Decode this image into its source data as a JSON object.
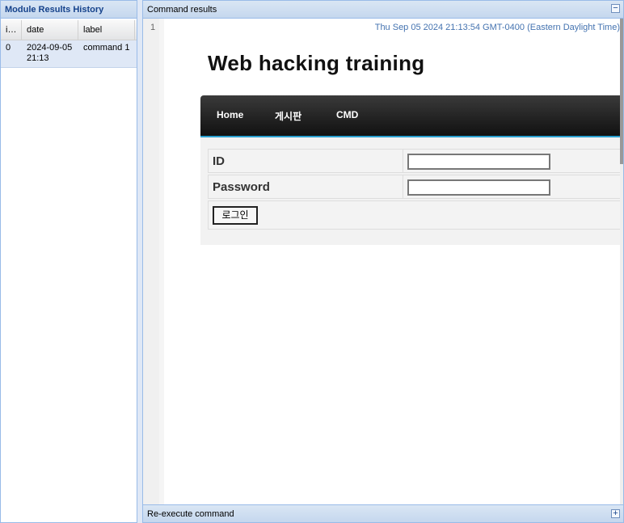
{
  "history_panel": {
    "title": "Module Results History",
    "columns": [
      "i…",
      "date",
      "label"
    ],
    "rows": [
      {
        "id": "0",
        "date_line1": "2024-09-05",
        "date_line2": "21:13",
        "label": "command 1"
      }
    ]
  },
  "results_panel": {
    "title": "Command results",
    "collapse_icon": "minus",
    "line_number": "1",
    "timestamp": "Thu Sep 05 2024 21:13:54 GMT-0400 (Eastern Daylight Time)",
    "page": {
      "title": "Web hacking training",
      "nav": [
        "Home",
        "게시판",
        "CMD"
      ],
      "id_label": "ID",
      "password_label": "Password",
      "login_button": "로그인"
    },
    "footer": "Re-execute command",
    "expand_icon": "plus"
  }
}
